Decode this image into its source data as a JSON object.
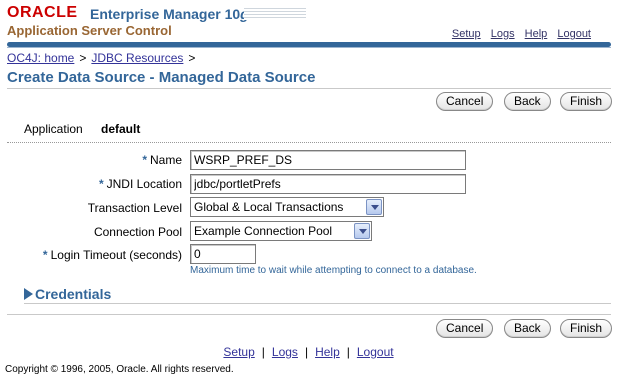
{
  "branding": {
    "oracle": "ORACLE",
    "product": "Enterprise Manager 10",
    "product_version": "g",
    "subtitle": "Application Server Control"
  },
  "global_links": [
    "Setup",
    "Logs",
    "Help",
    "Logout"
  ],
  "breadcrumb": [
    {
      "label": "OC4J: home",
      "sep": ">"
    },
    {
      "label": "JDBC Resources",
      "sep": ">"
    }
  ],
  "page_title": "Create Data Source - Managed Data Source",
  "buttons": {
    "cancel": "Cancel",
    "back": "Back",
    "finish": "Finish"
  },
  "application": {
    "label": "Application",
    "value": "default"
  },
  "form": {
    "required_mark": "*",
    "name": {
      "label": "Name",
      "value": "WSRP_PREF_DS"
    },
    "jndi": {
      "label": "JNDI Location",
      "value": "jdbc/portletPrefs"
    },
    "transaction_level": {
      "label": "Transaction Level",
      "value": "Global & Local Transactions"
    },
    "connection_pool": {
      "label": "Connection Pool",
      "value": "Example Connection Pool"
    },
    "login_timeout": {
      "label": "Login Timeout (seconds)",
      "value": "0",
      "hint": "Maximum time to wait while attempting to connect to a database."
    }
  },
  "credentials": {
    "label": "Credentials"
  },
  "footer": {
    "links": [
      "Setup",
      "Logs",
      "Help",
      "Logout"
    ],
    "pipe": "|",
    "copyright": "Copyright © 1996, 2005, Oracle. All rights reserved."
  },
  "colors": {
    "brand_red": "#cc0000",
    "brand_blue": "#336699",
    "brand_gold": "#996633"
  }
}
